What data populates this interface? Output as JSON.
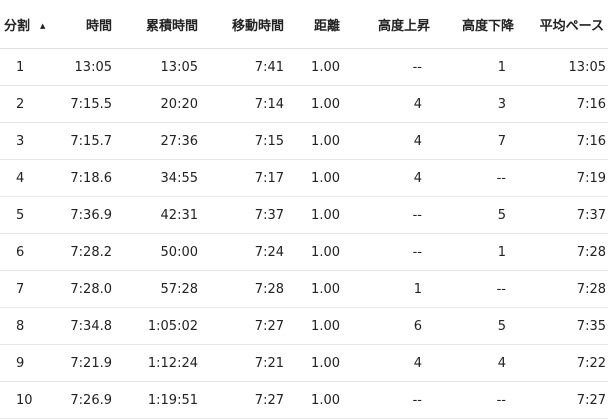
{
  "table": {
    "headers": [
      "分割",
      "時間",
      "累積時間",
      "移動時間",
      "距離",
      "高度上昇",
      "高度下降",
      "平均ペース"
    ],
    "sort_indicator": "▲",
    "rows": [
      [
        "1",
        "13:05",
        "13:05",
        "7:41",
        "1.00",
        "--",
        "1",
        "13:05"
      ],
      [
        "2",
        "7:15.5",
        "20:20",
        "7:14",
        "1.00",
        "4",
        "3",
        "7:16"
      ],
      [
        "3",
        "7:15.7",
        "27:36",
        "7:15",
        "1.00",
        "4",
        "7",
        "7:16"
      ],
      [
        "4",
        "7:18.6",
        "34:55",
        "7:17",
        "1.00",
        "4",
        "--",
        "7:19"
      ],
      [
        "5",
        "7:36.9",
        "42:31",
        "7:37",
        "1.00",
        "--",
        "5",
        "7:37"
      ],
      [
        "6",
        "7:28.2",
        "50:00",
        "7:24",
        "1.00",
        "--",
        "1",
        "7:28"
      ],
      [
        "7",
        "7:28.0",
        "57:28",
        "7:28",
        "1.00",
        "1",
        "--",
        "7:28"
      ],
      [
        "8",
        "7:34.8",
        "1:05:02",
        "7:27",
        "1.00",
        "6",
        "5",
        "7:35"
      ],
      [
        "9",
        "7:21.9",
        "1:12:24",
        "7:21",
        "1.00",
        "4",
        "4",
        "7:22"
      ],
      [
        "10",
        "7:26.9",
        "1:19:51",
        "7:27",
        "1.00",
        "--",
        "--",
        "7:27"
      ]
    ]
  }
}
